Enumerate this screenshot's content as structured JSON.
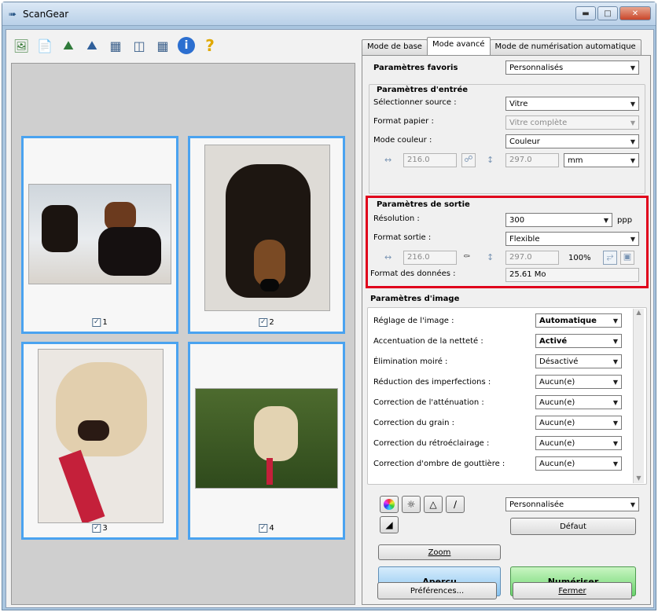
{
  "window": {
    "title": "ScanGear"
  },
  "toolbar_icons": [
    "scan-icon",
    "new-page-icon",
    "zoom-in-icon",
    "zoom-out-icon",
    "grid-view-icon",
    "list-view-icon",
    "thumbnail-view-icon",
    "info-icon",
    "help-icon"
  ],
  "thumbnails": [
    {
      "label": "1"
    },
    {
      "label": "2"
    },
    {
      "label": "3"
    },
    {
      "label": "4"
    }
  ],
  "tabs": [
    "Mode de base",
    "Mode avancé",
    "Mode de numérisation automatique"
  ],
  "fav": {
    "label": "Paramètres favoris",
    "value": "Personnalisés"
  },
  "input": {
    "heading": "Paramètres d'entrée",
    "source_label": "Sélectionner source :",
    "source_value": "Vitre",
    "paper_label": "Format papier :",
    "paper_value": "Vitre complète",
    "color_label": "Mode couleur :",
    "color_value": "Couleur",
    "width": "216.0",
    "height": "297.0",
    "unit": "mm"
  },
  "output": {
    "heading": "Paramètres de sortie",
    "res_label": "Résolution :",
    "res_value": "300",
    "res_unit": "ppp",
    "format_label": "Format sortie :",
    "format_value": "Flexible",
    "width": "216.0",
    "height": "297.0",
    "scale": "100%",
    "data_label": "Format des données :",
    "data_value": "25.61 Mo"
  },
  "image": {
    "heading": "Paramètres d'image",
    "rows": [
      {
        "label": "Réglage de l'image :",
        "value": "Automatique"
      },
      {
        "label": "Accentuation de la netteté :",
        "value": "Activé"
      },
      {
        "label": "Élimination moiré :",
        "value": "Désactivé"
      },
      {
        "label": "Réduction des imperfections :",
        "value": "Aucun(e)"
      },
      {
        "label": "Correction de l'atténuation :",
        "value": "Aucun(e)"
      },
      {
        "label": "Correction du grain :",
        "value": "Aucun(e)"
      },
      {
        "label": "Correction du rétroéclairage :",
        "value": "Aucun(e)"
      },
      {
        "label": "Correction d'ombre de gouttière :",
        "value": "Aucun(e)"
      }
    ]
  },
  "adjust": {
    "preset_value": "Personnalisée",
    "default_label": "Défaut"
  },
  "buttons": {
    "zoom": "Zoom",
    "preview": "Aperçu",
    "scan": "Numériser",
    "prefs": "Préférences...",
    "close": "Fermer"
  }
}
